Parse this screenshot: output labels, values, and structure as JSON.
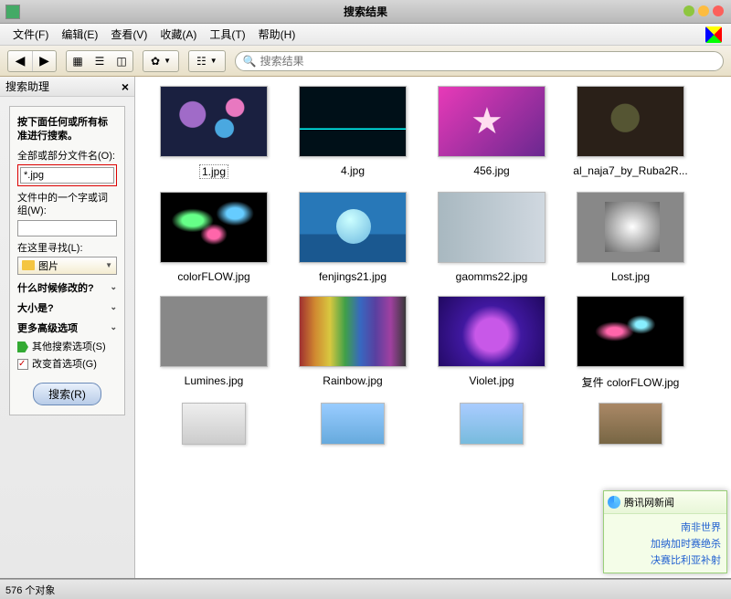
{
  "title": "搜索结果",
  "menus": {
    "file": "文件(F)",
    "edit": "编辑(E)",
    "view": "查看(V)",
    "fav": "收藏(A)",
    "tools": "工具(T)",
    "help": "帮助(H)"
  },
  "search_placeholder": "搜索结果",
  "sidebar": {
    "title": "搜索助理",
    "instruction": "按下面任何或所有标准进行搜索。",
    "filename_label": "全部或部分文件名(O):",
    "filename_value": "*.jpg",
    "word_label": "文件中的一个字或词组(W):",
    "word_value": "",
    "lookin_label": "在这里寻找(L):",
    "lookin_value": "图片",
    "when_label": "什么时候修改的?",
    "size_label": "大小是?",
    "more_label": "更多高级选项",
    "other_options": "其他搜索选项(S)",
    "change_prefs": "改变首选项(G)",
    "search_btn": "搜索(R)"
  },
  "files": [
    {
      "name": "1.jpg",
      "art": "t1",
      "selected": true
    },
    {
      "name": "4.jpg",
      "art": "t2"
    },
    {
      "name": "456.jpg",
      "art": "t3"
    },
    {
      "name": "al_naja7_by_Ruba2R...",
      "art": "t4"
    },
    {
      "name": "colorFLOW.jpg",
      "art": "t5"
    },
    {
      "name": "fenjings21.jpg",
      "art": "t6"
    },
    {
      "name": "gaomms22.jpg",
      "art": "t7"
    },
    {
      "name": "Lost.jpg",
      "art": "t8"
    },
    {
      "name": "Lumines.jpg",
      "art": "t9"
    },
    {
      "name": "Rainbow.jpg",
      "art": "t10"
    },
    {
      "name": "Violet.jpg",
      "art": "t11"
    },
    {
      "name": "复件 colorFLOW.jpg",
      "art": "t12"
    }
  ],
  "partial_files": [
    {
      "art": "t13"
    },
    {
      "art": "t14"
    },
    {
      "art": "t15"
    },
    {
      "art": "t16"
    }
  ],
  "status": "576 个对象",
  "popup": {
    "title": "腾讯网新闻",
    "lines": [
      "南非世界",
      "加纳加时赛绝杀",
      "决赛比利亚补射"
    ]
  }
}
